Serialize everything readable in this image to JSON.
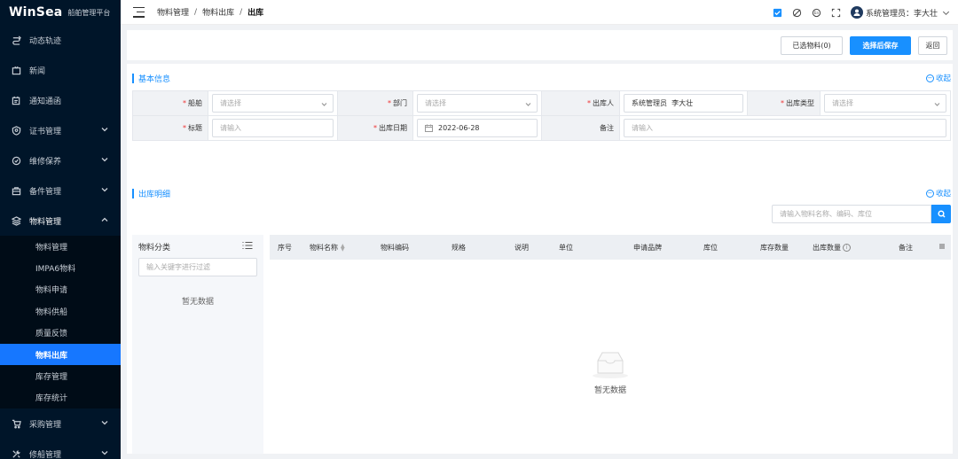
{
  "sidebar": {
    "brand": "WinSea",
    "subtitle": "船舶管理平台",
    "items": [
      {
        "label": "动态轨迹",
        "icon": "route-icon",
        "has_children": false
      },
      {
        "label": "新闻",
        "icon": "news-icon",
        "has_children": false
      },
      {
        "label": "通知通函",
        "icon": "notice-icon",
        "has_children": false
      },
      {
        "label": "证书管理",
        "icon": "certificate-icon",
        "has_children": true
      },
      {
        "label": "维修保养",
        "icon": "maintenance-icon",
        "has_children": true
      },
      {
        "label": "备件管理",
        "icon": "spare-parts-icon",
        "has_children": true
      },
      {
        "label": "物料管理",
        "icon": "materials-icon",
        "has_children": true,
        "expanded": true
      }
    ],
    "submenu": [
      {
        "label": "物料管理",
        "active": false
      },
      {
        "label": "IMPA6物料",
        "active": false
      },
      {
        "label": "物料申请",
        "active": false
      },
      {
        "label": "物料供船",
        "active": false
      },
      {
        "label": "质量反馈",
        "active": false
      },
      {
        "label": "物料出库",
        "active": true
      },
      {
        "label": "库存管理",
        "active": false
      },
      {
        "label": "库存统计",
        "active": false
      }
    ],
    "items_after": [
      {
        "label": "采购管理",
        "icon": "cart-icon",
        "has_children": true
      },
      {
        "label": "修船管理",
        "icon": "repair-icon",
        "has_children": true
      }
    ],
    "active_color": "#1677ff"
  },
  "header": {
    "breadcrumb": [
      "物料管理",
      "物料出库",
      "出库"
    ],
    "user_label": "系统管理员：李大壮"
  },
  "toolbar": {
    "selected_label": "已选物料(0)",
    "save_label": "选择后保存",
    "back_label": "返回"
  },
  "basic_info": {
    "title": "基本信息",
    "collapse_label": "收起",
    "fields": {
      "ship": {
        "label": "船舶",
        "placeholder": "请选择"
      },
      "dept": {
        "label": "部门",
        "placeholder": "请选择"
      },
      "operator": {
        "label": "出库人",
        "value": "系统管理员  李大壮"
      },
      "type": {
        "label": "出库类型",
        "placeholder": "请选择"
      },
      "title": {
        "label": "标题",
        "placeholder": "请输入"
      },
      "date": {
        "label": "出库日期",
        "value": "2022-06-28"
      },
      "remark": {
        "label": "备注",
        "placeholder": "请输入"
      }
    }
  },
  "detail": {
    "title": "出库明细",
    "collapse_label": "收起",
    "search_placeholder": "请输入物料名称、编码、库位",
    "category": {
      "title": "物料分类",
      "filter_placeholder": "输入关键字进行过滤",
      "empty_text": "暂无数据"
    },
    "columns": [
      "序号",
      "物料名称",
      "物料编码",
      "规格",
      "说明",
      "单位",
      "申请品牌",
      "库位",
      "库存数量",
      "出库数量",
      "备注"
    ],
    "empty_text": "暂无数据"
  },
  "colors": {
    "primary": "#1890ff",
    "sidebar_bg": "#001529",
    "required": "#ee3333"
  }
}
